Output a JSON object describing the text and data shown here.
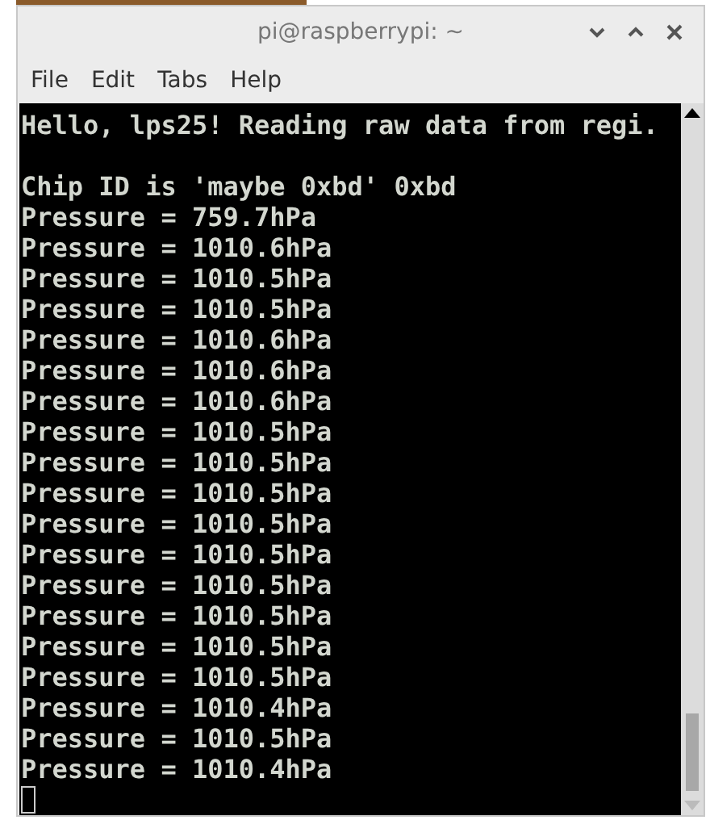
{
  "window": {
    "title": "pi@raspberrypi: ~"
  },
  "menu": [
    "File",
    "Edit",
    "Tabs",
    "Help"
  ],
  "terminal": {
    "blocks": [
      [
        "Hello, lps25! Reading raw data from regi."
      ],
      [
        "Chip ID is 'maybe 0xbd' 0xbd",
        "Pressure = 759.7hPa",
        "Pressure = 1010.6hPa",
        "Pressure = 1010.5hPa",
        "Pressure = 1010.5hPa",
        "Pressure = 1010.6hPa",
        "Pressure = 1010.6hPa",
        "Pressure = 1010.6hPa",
        "Pressure = 1010.5hPa",
        "Pressure = 1010.5hPa",
        "Pressure = 1010.5hPa",
        "Pressure = 1010.5hPa",
        "Pressure = 1010.5hPa",
        "Pressure = 1010.5hPa",
        "Pressure = 1010.5hPa",
        "Pressure = 1010.5hPa",
        "Pressure = 1010.5hPa",
        "Pressure = 1010.4hPa",
        "Pressure = 1010.5hPa",
        "Pressure = 1010.4hPa"
      ]
    ]
  }
}
